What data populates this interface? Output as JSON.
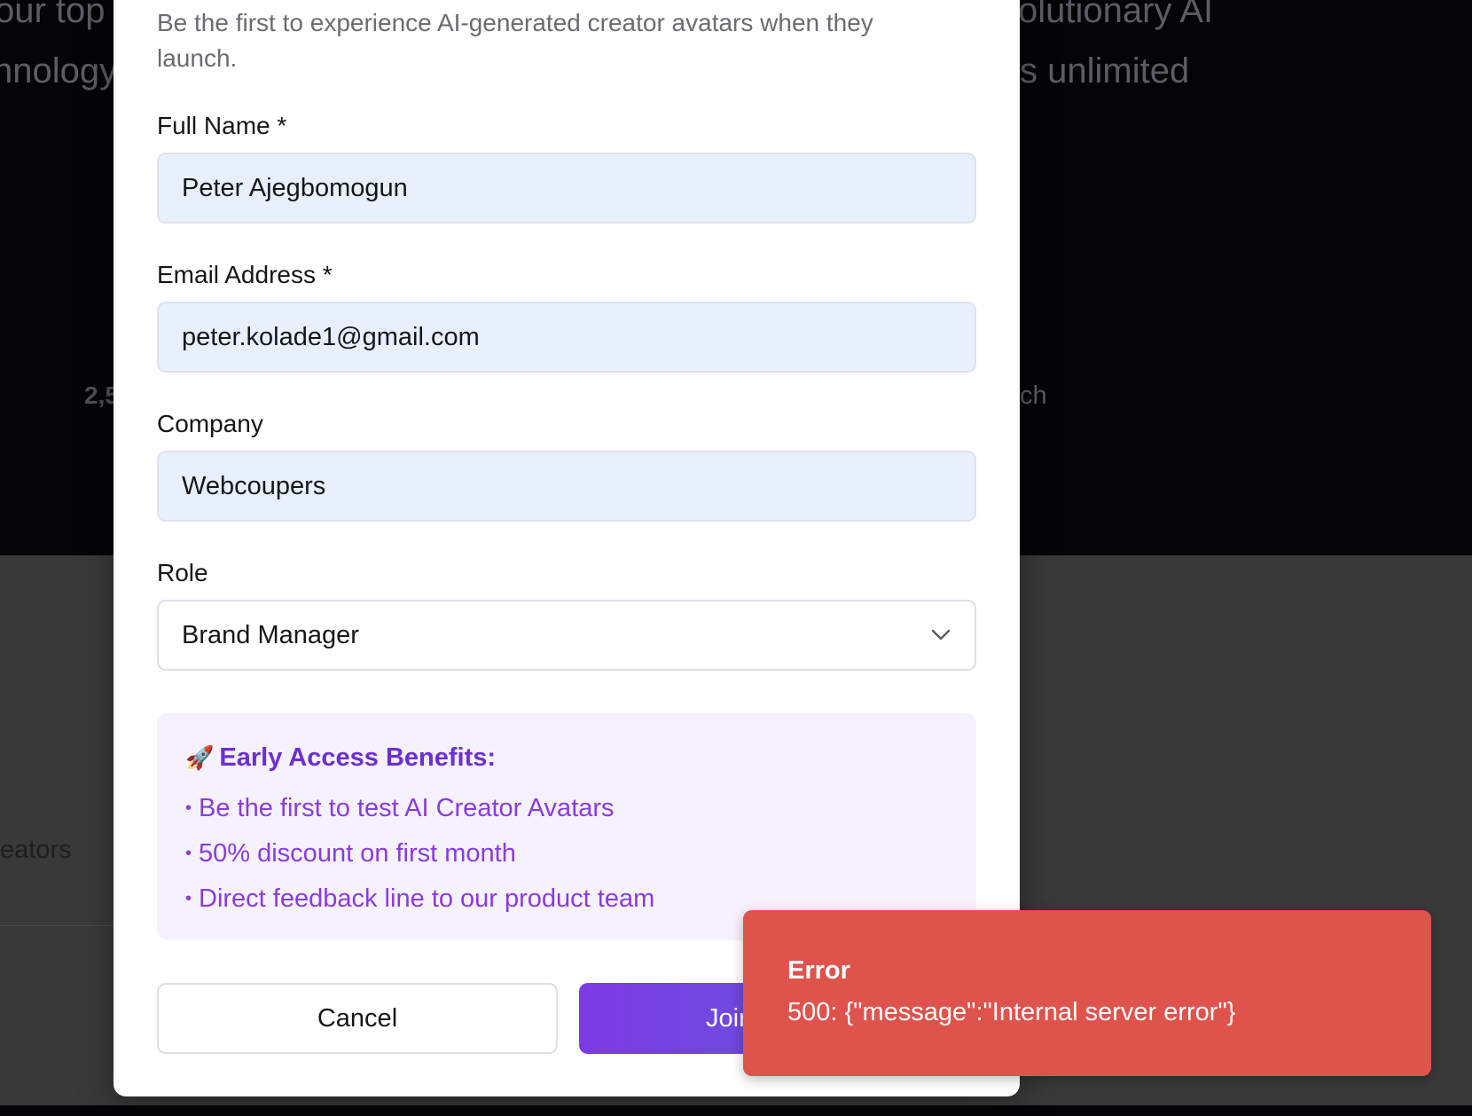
{
  "background": {
    "hero_line1_left": "our top",
    "hero_line1_right": "olutionary AI",
    "hero_line2_left": "nnology",
    "hero_line2_right": "s unlimited",
    "stat_left": "2,5",
    "stat_right": "ch",
    "lower_left_text": "eators"
  },
  "modal": {
    "subtitle": "Be the first to experience AI-generated creator avatars when they launch.",
    "fields": {
      "full_name": {
        "label": "Full Name *",
        "value": "Peter Ajegbomogun"
      },
      "email": {
        "label": "Email Address *",
        "value": "peter.kolade1@gmail.com"
      },
      "company": {
        "label": "Company",
        "value": "Webcoupers"
      },
      "role": {
        "label": "Role",
        "value": "Brand Manager"
      }
    },
    "benefits": {
      "emoji": "🚀",
      "title": "Early Access Benefits:",
      "bullet": "•",
      "items": [
        "Be the first to test AI Creator Avatars",
        "50% discount on first month",
        "Direct feedback line to our product team"
      ]
    },
    "buttons": {
      "cancel": "Cancel",
      "join": "Join"
    }
  },
  "toast": {
    "title": "Error",
    "message": "500: {\"message\":\"Internal server error\"}"
  }
}
